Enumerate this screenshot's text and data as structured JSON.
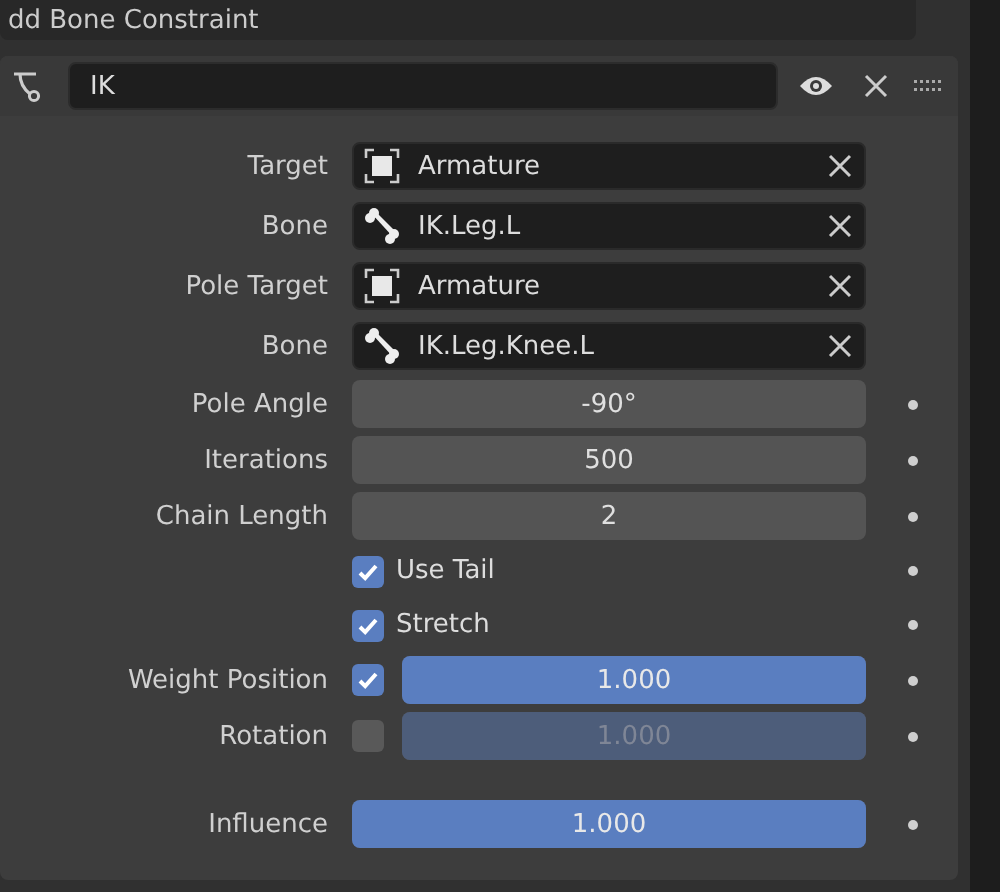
{
  "top_button": {
    "label": "dd Bone Constraint"
  },
  "constraint": {
    "name": "IK",
    "visible": true
  },
  "rows": [
    {
      "kind": "object",
      "label": "Target",
      "value": "Armature"
    },
    {
      "kind": "bone",
      "label": "Bone",
      "value": "IK.Leg.L"
    },
    {
      "kind": "object",
      "label": "Pole Target",
      "value": "Armature"
    },
    {
      "kind": "bone",
      "label": "Bone",
      "value": "IK.Leg.Knee.L"
    },
    {
      "kind": "number",
      "label": "Pole Angle",
      "value": "-90°"
    },
    {
      "kind": "number",
      "label": "Iterations",
      "value": "500"
    },
    {
      "kind": "number",
      "label": "Chain Length",
      "value": "2"
    },
    {
      "kind": "checkbox",
      "label": "Use Tail",
      "checked": true
    },
    {
      "kind": "checkbox",
      "label": "Stretch",
      "checked": true
    },
    {
      "kind": "weight",
      "label": "Weight Position",
      "checked": true,
      "value": "1.000",
      "level": 1
    },
    {
      "kind": "weight",
      "label": "Rotation",
      "checked": false,
      "value": "1.000",
      "level": 1
    }
  ],
  "influence": {
    "label": "Influence",
    "value": "1.000",
    "level": 1
  }
}
